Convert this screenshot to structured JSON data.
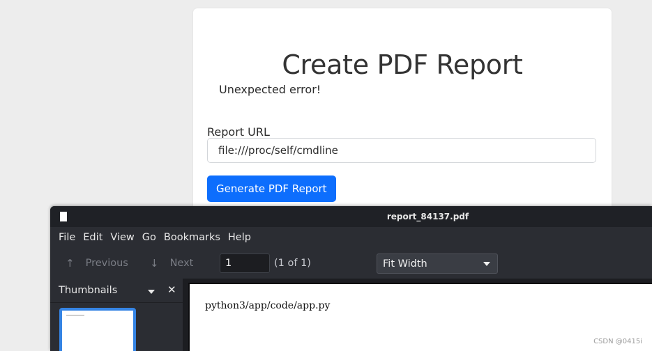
{
  "form": {
    "title": "Create PDF Report",
    "error": "Unexpected error!",
    "url_label": "Report URL",
    "url_value": "file:///proc/self/cmdline",
    "submit_label": "Generate PDF Report"
  },
  "viewer": {
    "window_title": "report_84137.pdf",
    "menu": [
      "File",
      "Edit",
      "View",
      "Go",
      "Bookmarks",
      "Help"
    ],
    "toolbar": {
      "previous_label": "Previous",
      "next_label": "Next",
      "page_value": "1",
      "page_count": "(1 of 1)",
      "zoom_selected": "Fit Width"
    },
    "sidebar": {
      "title": "Thumbnails"
    },
    "page_text": "python3/app/code/app.py"
  },
  "watermark": "CSDN @0415i",
  "colors": {
    "primary_button": "#0d6efd",
    "thumb_selected": "#3584e4"
  }
}
